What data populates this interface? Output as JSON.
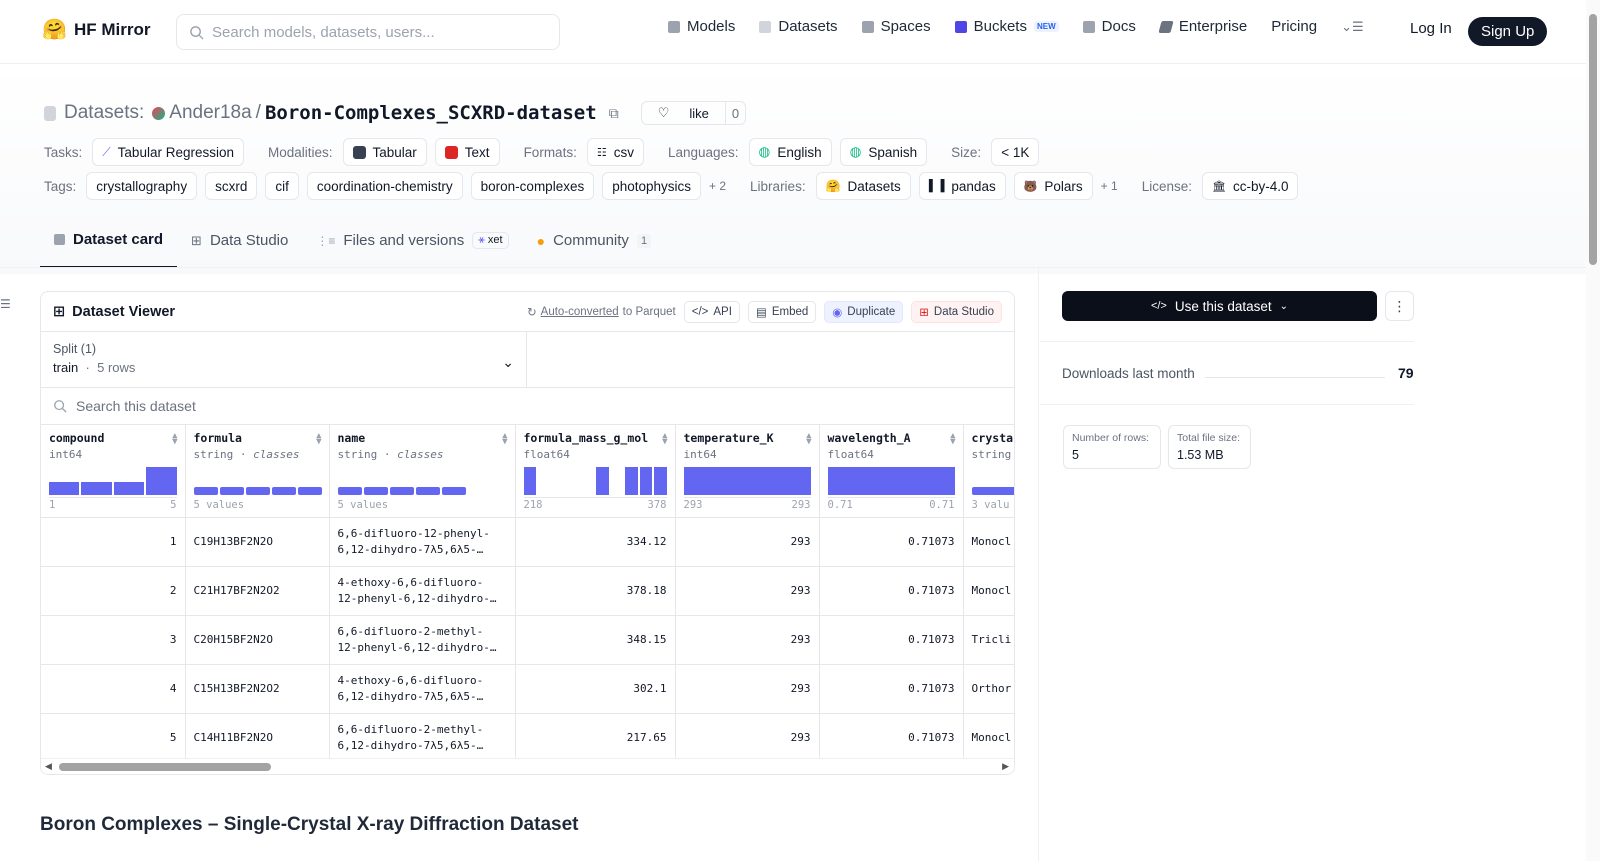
{
  "nav": {
    "brand": "HF Mirror",
    "search_placeholder": "Search models, datasets, users...",
    "items": [
      {
        "label": "Models",
        "color": "#9ca3af"
      },
      {
        "label": "Datasets",
        "color": "#d1d5db"
      },
      {
        "label": "Spaces",
        "color": "#9ca3af"
      },
      {
        "label": "Buckets",
        "color": "#4f46e5",
        "badge": "NEW"
      },
      {
        "label": "Docs",
        "color": "#9ca3af"
      },
      {
        "label": "Enterprise",
        "color": "#6b7280"
      },
      {
        "label": "Pricing"
      }
    ],
    "login": "Log In",
    "signup": "Sign Up"
  },
  "dataset": {
    "section": "Datasets:",
    "owner": "Ander18a",
    "sep": "/",
    "name": "Boron-Complexes_SCXRD-dataset",
    "like_label": "like",
    "like_count": "0"
  },
  "meta": {
    "tasks_label": "Tasks:",
    "tasks": [
      "Tabular Regression"
    ],
    "modalities_label": "Modalities:",
    "modalities": [
      "Tabular",
      "Text"
    ],
    "formats_label": "Formats:",
    "formats": [
      "csv"
    ],
    "languages_label": "Languages:",
    "languages": [
      "English",
      "Spanish"
    ],
    "size_label": "Size:",
    "size": "< 1K",
    "tags_label": "Tags:",
    "tags": [
      "crystallography",
      "scxrd",
      "cif",
      "coordination-chemistry",
      "boron-complexes",
      "photophysics"
    ],
    "tags_more": "+ 2",
    "libraries_label": "Libraries:",
    "libraries": [
      "Datasets",
      "pandas",
      "Polars"
    ],
    "libraries_more": "+ 1",
    "license_label": "License:",
    "license": "cc-by-4.0"
  },
  "tabs": [
    {
      "label": "Dataset card",
      "active": true
    },
    {
      "label": "Data Studio"
    },
    {
      "label": "Files and versions",
      "badge": "xet"
    },
    {
      "label": "Community",
      "count": "1"
    }
  ],
  "viewer": {
    "title": "Dataset Viewer",
    "auto_converted": "Auto-converted",
    "to_parquet": "to Parquet",
    "api": "API",
    "embed": "Embed",
    "duplicate": "Duplicate",
    "data_studio": "Data Studio",
    "split_label": "Split (1)",
    "split_name": "train",
    "split_rows": "5 rows",
    "search_placeholder": "Search this dataset",
    "columns": [
      {
        "name": "compound",
        "type": "int64",
        "min": "1",
        "max": "5"
      },
      {
        "name": "formula",
        "type": "string",
        "type_extra": "classes",
        "summary": "5 values"
      },
      {
        "name": "name",
        "type": "string",
        "type_extra": "classes",
        "summary": "5 values"
      },
      {
        "name": "formula_mass_g_mol",
        "type": "float64",
        "min": "218",
        "max": "378"
      },
      {
        "name": "temperature_K",
        "type": "int64",
        "min": "293",
        "max": "293"
      },
      {
        "name": "wavelength_A",
        "type": "float64",
        "min": "0.71",
        "max": "0.71"
      },
      {
        "name": "crysta",
        "type": "string",
        "summary": "3 valu"
      }
    ],
    "rows": [
      {
        "compound": "1",
        "formula": "C19H13BF2N2O",
        "name1": "6,6-difluoro-12-phenyl-",
        "name2": "6,12-dihydro-7λ5,6λ5-…",
        "mass": "334.12",
        "temp": "293",
        "wl": "0.71073",
        "crys": "Monocl"
      },
      {
        "compound": "2",
        "formula": "C21H17BF2N2O2",
        "name1": "4-ethoxy-6,6-difluoro-",
        "name2": "12-phenyl-6,12-dihydro-…",
        "mass": "378.18",
        "temp": "293",
        "wl": "0.71073",
        "crys": "Monocl"
      },
      {
        "compound": "3",
        "formula": "C20H15BF2N2O",
        "name1": "6,6-difluoro-2-methyl-",
        "name2": "12-phenyl-6,12-dihydro-…",
        "mass": "348.15",
        "temp": "293",
        "wl": "0.71073",
        "crys": "Tricli"
      },
      {
        "compound": "4",
        "formula": "C15H13BF2N2O2",
        "name1": "4-ethoxy-6,6-difluoro-",
        "name2": "6,12-dihydro-7λ5,6λ5-…",
        "mass": "302.1",
        "temp": "293",
        "wl": "0.71073",
        "crys": "Orthor"
      },
      {
        "compound": "5",
        "formula": "C14H11BF2N2O",
        "name1": "6,6-difluoro-2-methyl-",
        "name2": "6,12-dihydro-7λ5,6λ5-…",
        "mass": "217.65",
        "temp": "293",
        "wl": "0.71073",
        "crys": "Monocl"
      }
    ]
  },
  "card_heading": "Boron Complexes – Single-Crystal X-ray Diffraction Dataset",
  "sidebar": {
    "use_button": "Use this dataset",
    "downloads_label": "Downloads last month",
    "downloads_value": "79",
    "rows_label": "Number of rows:",
    "rows_value": "5",
    "filesize_label": "Total file size:",
    "filesize_value": "1.53 MB"
  },
  "colors": {
    "accent": "#6366f1",
    "dark": "#111827"
  }
}
